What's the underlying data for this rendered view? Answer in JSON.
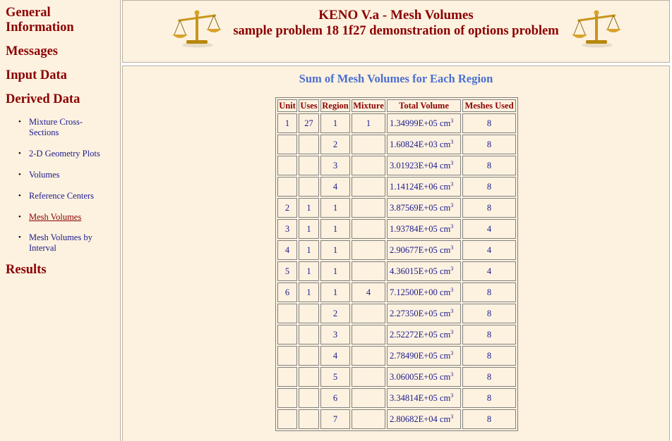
{
  "nav": {
    "headings": [
      "General Information",
      "Messages",
      "Input Data",
      "Derived Data",
      "Results"
    ],
    "sub_items": [
      "Mixture Cross-Sections",
      "2-D Geometry Plots",
      "Volumes",
      "Reference Centers",
      "Mesh Volumes",
      "Mesh Volumes by Interval"
    ],
    "active_sub_item": "Mesh Volumes",
    "bullet": "•"
  },
  "header": {
    "title": "KENO V.a - Mesh Volumes",
    "subtitle": "sample problem 18 1f27 demonstration of options problem",
    "icon": "scales-of-justice-icon"
  },
  "main": {
    "table_title": "Sum of Mesh Volumes for Each Region",
    "columns": [
      "Unit",
      "Uses",
      "Region",
      "Mixture",
      "Total Volume",
      "Meshes Used"
    ],
    "unit_suffix": "cm",
    "unit_exponent": "3",
    "rows": [
      {
        "unit": "1",
        "uses": "27",
        "region": "1",
        "mixture": "1",
        "volume": "1.34999E+05",
        "meshes": "8"
      },
      {
        "unit": "",
        "uses": "",
        "region": "2",
        "mixture": "",
        "volume": "1.60824E+03",
        "meshes": "8"
      },
      {
        "unit": "",
        "uses": "",
        "region": "3",
        "mixture": "",
        "volume": "3.01923E+04",
        "meshes": "8"
      },
      {
        "unit": "",
        "uses": "",
        "region": "4",
        "mixture": "",
        "volume": "1.14124E+06",
        "meshes": "8"
      },
      {
        "unit": "2",
        "uses": "1",
        "region": "1",
        "mixture": "",
        "volume": "3.87569E+05",
        "meshes": "8"
      },
      {
        "unit": "3",
        "uses": "1",
        "region": "1",
        "mixture": "",
        "volume": "1.93784E+05",
        "meshes": "4"
      },
      {
        "unit": "4",
        "uses": "1",
        "region": "1",
        "mixture": "",
        "volume": "2.90677E+05",
        "meshes": "4"
      },
      {
        "unit": "5",
        "uses": "1",
        "region": "1",
        "mixture": "",
        "volume": "4.36015E+05",
        "meshes": "4"
      },
      {
        "unit": "6",
        "uses": "1",
        "region": "1",
        "mixture": "4",
        "volume": "7.12500E+00",
        "meshes": "8"
      },
      {
        "unit": "",
        "uses": "",
        "region": "2",
        "mixture": "",
        "volume": "2.27350E+05",
        "meshes": "8"
      },
      {
        "unit": "",
        "uses": "",
        "region": "3",
        "mixture": "",
        "volume": "2.52272E+05",
        "meshes": "8"
      },
      {
        "unit": "",
        "uses": "",
        "region": "4",
        "mixture": "",
        "volume": "2.78490E+05",
        "meshes": "8"
      },
      {
        "unit": "",
        "uses": "",
        "region": "5",
        "mixture": "",
        "volume": "3.06005E+05",
        "meshes": "8"
      },
      {
        "unit": "",
        "uses": "",
        "region": "6",
        "mixture": "",
        "volume": "3.34814E+05",
        "meshes": "8"
      },
      {
        "unit": "",
        "uses": "",
        "region": "7",
        "mixture": "",
        "volume": "2.80682E+04",
        "meshes": "8"
      }
    ]
  },
  "colors": {
    "panel_bg": "#fdf2e0",
    "heading": "#8b0000",
    "link": "#1a1a8c",
    "table_title": "#4a6fd0"
  }
}
